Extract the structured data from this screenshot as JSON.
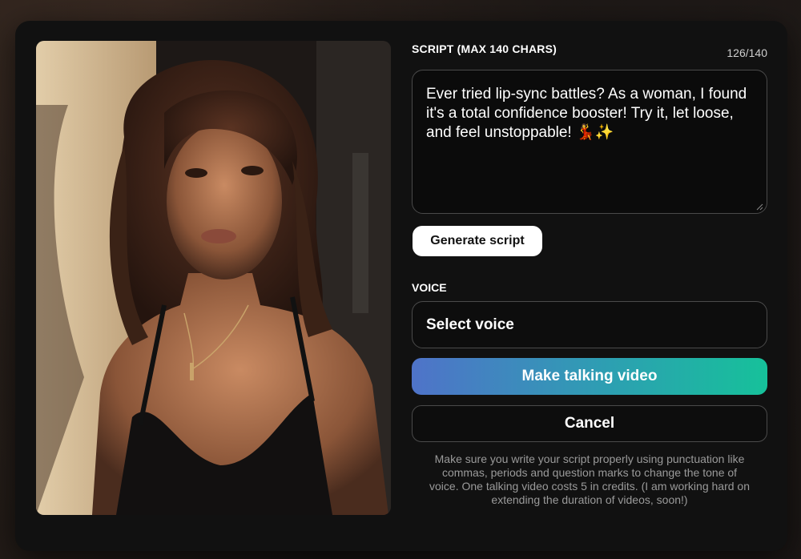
{
  "script": {
    "label": "SCRIPT (MAX 140 CHARS)",
    "char_count": "126/140",
    "text": "Ever tried lip-sync battles? As a woman, I found it's a total confidence booster! Try it, let loose, and feel unstoppable! 💃✨"
  },
  "buttons": {
    "generate_script": "Generate script",
    "make_video": "Make talking video",
    "cancel": "Cancel"
  },
  "voice": {
    "label": "VOICE",
    "selected": "Select voice"
  },
  "note": "Make sure you write your script properly using punctuation like commas, periods and question marks to change the tone of voice. One talking video costs 5 in credits. (I am working hard on extending the duration of videos, soon!)",
  "colors": {
    "modal_bg": "#111111",
    "button_gradient_start": "#4f73c9",
    "button_gradient_end": "#16c19a"
  }
}
